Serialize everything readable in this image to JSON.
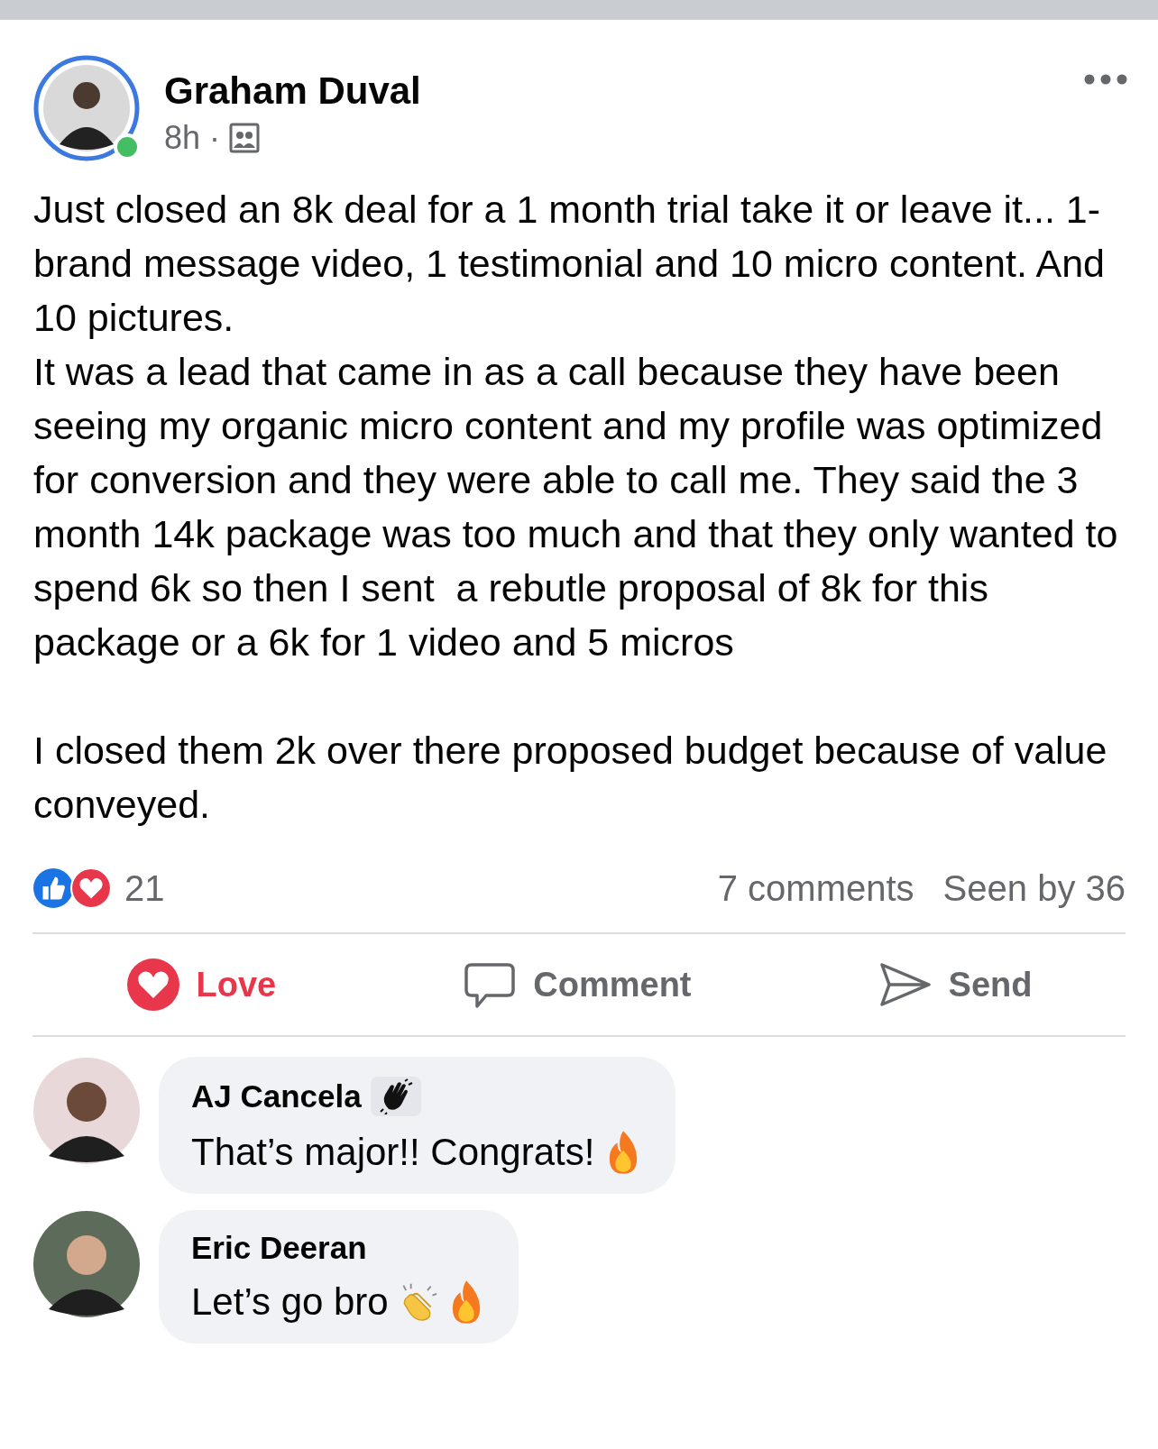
{
  "post": {
    "author": "Graham Duval",
    "online": true,
    "time": "8h",
    "separator": "·",
    "paragraphs": [
      "Just closed an 8k deal for a 1 month trial take it or leave it... 1-brand message video, 1 testimonial and 10 micro content. And 10 pictures.",
      "It was a lead that came in as a call because they have been seeing my organic micro content and my profile was optimized for conversion and they were able to call me. They said the 3 month 14k package was too much and that they only wanted to spend 6k so then I sent  a rebutle proposal of 8k for this package or a 6k for 1 video and 5 micros",
      "I closed them 2k over there proposed budget because of value conveyed."
    ],
    "reaction_count": "21",
    "comments_count": "7 comments",
    "seen_by": "Seen by 36"
  },
  "actions": [
    {
      "label": "Love",
      "kind": "love",
      "selected": true
    },
    {
      "label": "Comment",
      "kind": "comment",
      "selected": false
    },
    {
      "label": "Send",
      "kind": "send",
      "selected": false
    }
  ],
  "comments": [
    {
      "author": "AJ Cancela",
      "badge": {
        "kind": "wave"
      },
      "text": "That’s major!! Congrats!",
      "emojis": [
        {
          "kind": "fire"
        }
      ]
    },
    {
      "author": "Eric Deeran",
      "text": "Let’s go bro",
      "emojis": [
        {
          "kind": "clap"
        },
        {
          "kind": "fire"
        }
      ]
    }
  ]
}
